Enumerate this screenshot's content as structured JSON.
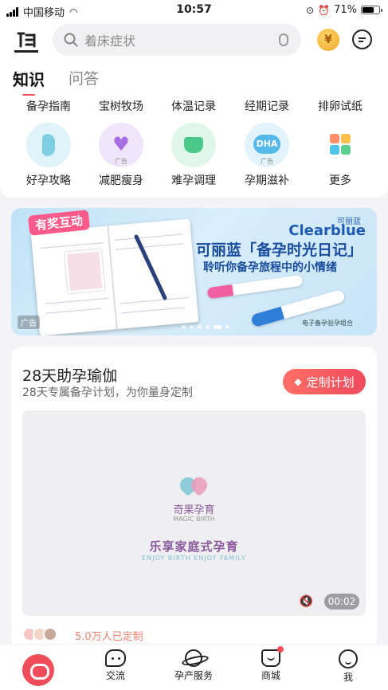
{
  "status_bar": {
    "carrier": "中国移动",
    "time": "10:57",
    "battery": "71%"
  },
  "search": {
    "placeholder": "着床症状"
  },
  "coin_symbol": "¥",
  "tabs": [
    {
      "label": "知识",
      "active": true
    },
    {
      "label": "问答",
      "active": false
    }
  ],
  "shortcuts_row1": [
    "备孕指南",
    "宝树牧场",
    "体温记录",
    "经期记录",
    "排卵试纸"
  ],
  "shortcuts_row2": [
    {
      "label": "好孕攻略",
      "icon": "pregnant-woman-icon",
      "ad": ""
    },
    {
      "label": "减肥瘦身",
      "icon": "slim-body-icon",
      "ad": "广告"
    },
    {
      "label": "难孕调理",
      "icon": "teapot-icon",
      "ad": ""
    },
    {
      "label": "孕期滋补",
      "icon": "dha-icon",
      "ad": "广告",
      "icon_text": "DHA"
    },
    {
      "label": "更多",
      "icon": "grid-more-icon",
      "ad": ""
    }
  ],
  "banner": {
    "badge": "有奖互动",
    "brand_cn": "可丽蓝",
    "brand_en": "Clearblue",
    "title": "可丽蓝「备孕时光日记」",
    "subtitle": "聆听你备孕旅程中的小情绪",
    "caption": "电子备孕验孕组合",
    "ad_label": "广告",
    "slide_count": 6,
    "active_slide": 4
  },
  "course": {
    "title": "28天助孕瑜伽",
    "subtitle": "28天专属备孕计划，为你量身定制",
    "button": "定制计划",
    "video": {
      "brand": "奇果孕育",
      "brand_en": "MAGIC BIRTH",
      "slogan": "乐享家庭式孕育",
      "slogan_en": "ENJOY BIRTH ENJOY FAMILY",
      "duration": "00:02"
    },
    "customized_count": "5.0万人已定制"
  },
  "bottom_nav": [
    {
      "label": "",
      "icon": "home-icon",
      "active": true
    },
    {
      "label": "交流",
      "icon": "chat-icon"
    },
    {
      "label": "孕产服务",
      "icon": "planet-icon"
    },
    {
      "label": "商城",
      "icon": "shop-bag-icon",
      "badge": true
    },
    {
      "label": "我",
      "icon": "profile-icon"
    }
  ],
  "colors": {
    "accent": "#f04d5b",
    "brand_blue": "#1f5bb5"
  }
}
